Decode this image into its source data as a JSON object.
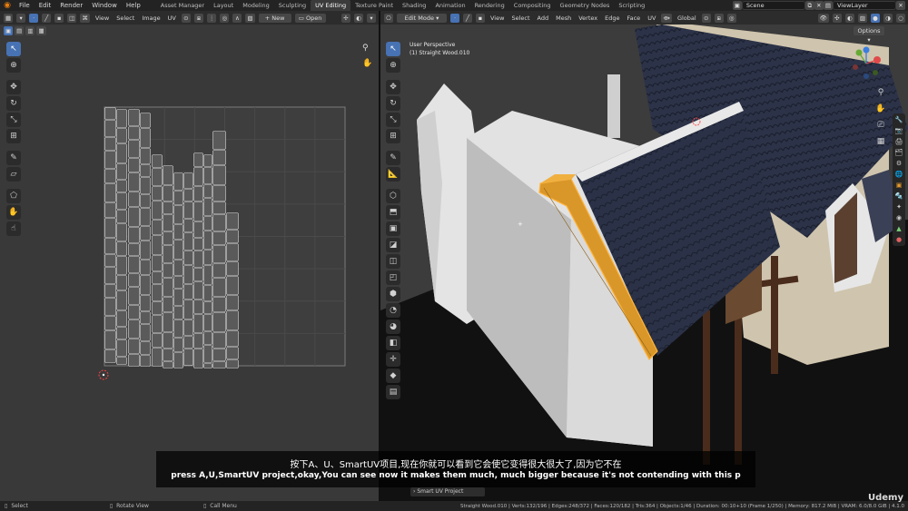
{
  "menu": [
    "File",
    "Edit",
    "Render",
    "Window",
    "Help"
  ],
  "workspaces": [
    "Asset Manager",
    "Layout",
    "Modeling",
    "Sculpting",
    "UV Editing",
    "Texture Paint",
    "Shading",
    "Animation",
    "Rendering",
    "Compositing",
    "Geometry Nodes",
    "Scripting"
  ],
  "active_workspace": "UV Editing",
  "scene": "Scene",
  "view_layer": "ViewLayer",
  "uv_header": {
    "view": "View",
    "select": "Select",
    "image": "Image",
    "uv": "UV",
    "new": "New",
    "open": "Open"
  },
  "vp_header": {
    "mode": "Edit Mode",
    "view": "View",
    "select": "Select",
    "add": "Add",
    "mesh": "Mesh",
    "vertex": "Vertex",
    "edge": "Edge",
    "face": "Face",
    "uv": "UV",
    "orientation": "Global",
    "options": "Options"
  },
  "viewport_info": {
    "perspective": "User Perspective",
    "object": "(1) Straight Wood.010"
  },
  "status": {
    "select": "Select",
    "rotate": "Rotate View",
    "menu": "Call Menu",
    "last_op": "Smart UV Project",
    "stats": "Straight Wood.010 | Verts:132/196 | Edges:248/372 | Faces:120/182 | Tris:364 | Objects:1/46 | Duration: 00:10+10 (Frame 1/250) | Memory: 817.2 MiB | VRAM: 6.0/8.0 GiB | 4.1.0"
  },
  "subtitle": {
    "cn": "按下A、U、SmartUV项目,现在你就可以看到它会使它变得很大很大了,因为它不在",
    "en": "press A,U,SmartUV project,okay,You can see now it makes them much, much bigger because it's not contending with this p"
  },
  "watermark": "Udemy",
  "colors": {
    "accent": "#4772b3",
    "selection": "#f0a020",
    "roof": "#2b3247",
    "wall": "#d8d8d8"
  }
}
